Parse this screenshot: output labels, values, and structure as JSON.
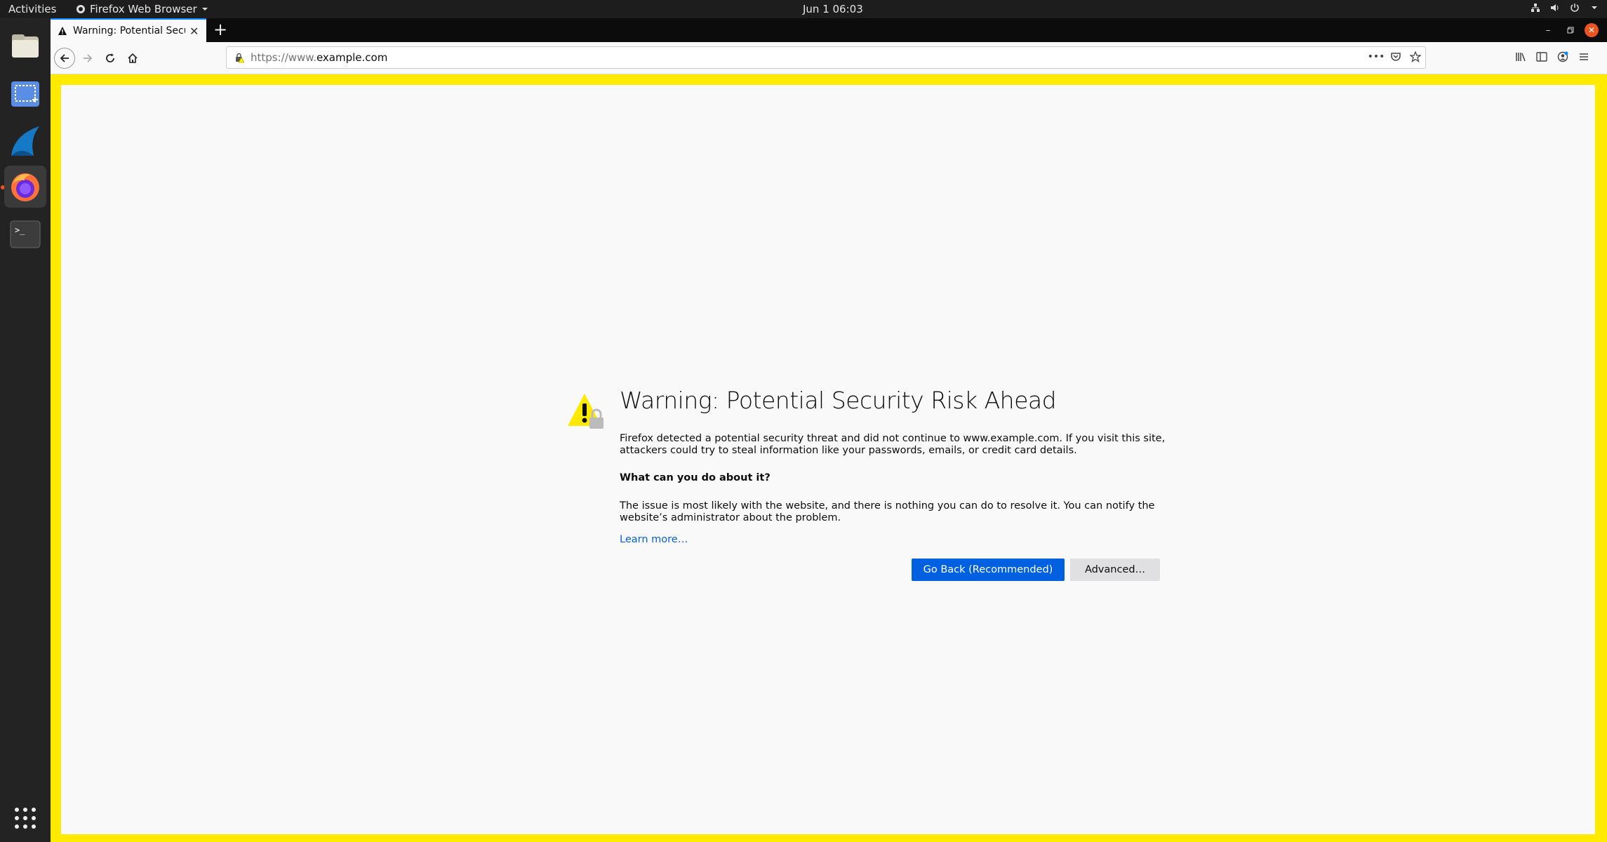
{
  "topbar": {
    "activities": "Activities",
    "app_name": "Firefox Web Browser",
    "clock": "Jun 1  06:03",
    "tray_icons": [
      "network-icon",
      "volume-icon",
      "power-icon",
      "chevron-down-icon"
    ]
  },
  "dock": {
    "items": [
      "files-icon",
      "screenshot-icon",
      "wireshark-icon",
      "firefox-icon",
      "terminal-icon"
    ],
    "apps_grid": "apps-grid-icon"
  },
  "browser": {
    "tab": {
      "title": "Warning: Potential Security Risk Ahead"
    },
    "url": {
      "protocol": "https://www.",
      "host": "example.com"
    }
  },
  "error_page": {
    "title": "Warning: Potential Security Risk Ahead",
    "description": "Firefox detected a potential security threat and did not continue to www.example.com. If you visit this site, attackers could try to steal information like your passwords, emails, or credit card details.",
    "subheading": "What can you do about it?",
    "advice": "The issue is most likely with the website, and there is nothing you can do to resolve it. You can notify the website’s administrator about the problem.",
    "learn_more": "Learn more…",
    "go_back_label": "Go Back (Recommended)",
    "advanced_label": "Advanced…"
  },
  "colors": {
    "accent": "#0060df",
    "highlight_border": "#ffea00",
    "warning": "#ffe900",
    "ubuntu_orange": "#e95420"
  }
}
